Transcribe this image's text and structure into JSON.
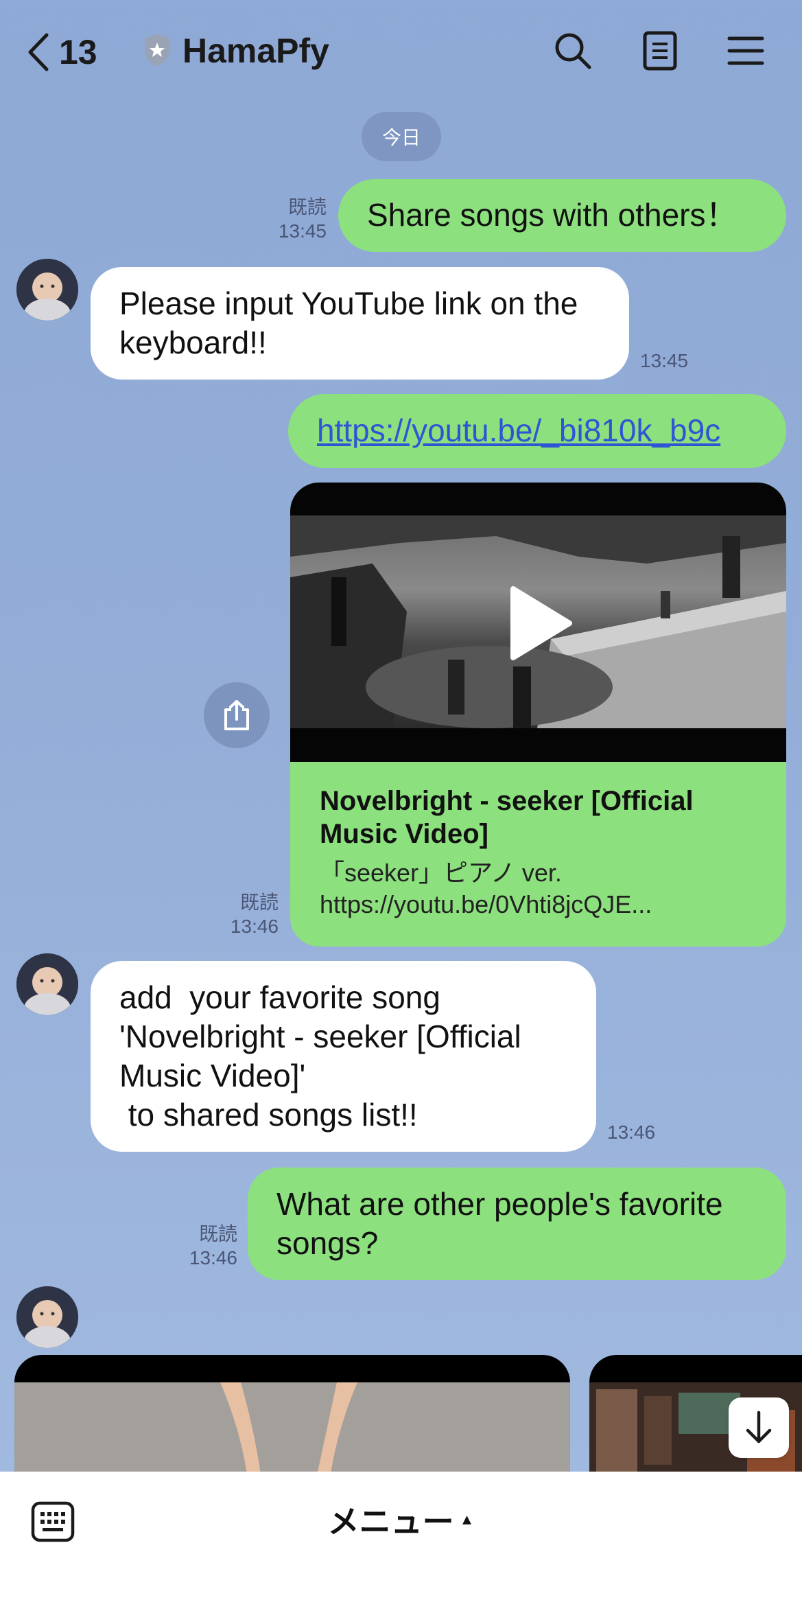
{
  "header": {
    "back_count": "13",
    "title": "HamaPfy"
  },
  "date_chip": "今日",
  "messages": [
    {
      "side": "right",
      "text": "Share songs with others！",
      "read": "既読",
      "time": "13:45"
    },
    {
      "side": "left",
      "text": "Please input YouTube link on the keyboard!!",
      "time": "13:45"
    },
    {
      "side": "right",
      "text": "https://youtu.be/_bi810k_b9c",
      "link": true
    },
    {
      "side": "right",
      "type": "link-card",
      "title": "Novelbright - seeker [Official Music Video]",
      "desc_line1": "「seeker」ピアノ ver.",
      "desc_line2": "https://youtu.be/0Vhti8jcQJE...",
      "read": "既読",
      "time": "13:46"
    },
    {
      "side": "left",
      "text_lines": [
        "add  your favorite song",
        "'Novelbright - seeker [Official",
        "Music Video]'",
        " to shared songs list!!"
      ],
      "time": "13:46"
    },
    {
      "side": "right",
      "text_lines": [
        "What are other people's favorite",
        "songs?"
      ],
      "read": "既読",
      "time": "13:46"
    }
  ],
  "bottom": {
    "menu_label": "メニュー",
    "menu_caret": "▲"
  },
  "colors": {
    "background": "#93add8",
    "outgoing_bubble": "#8de07e",
    "incoming_bubble": "#ffffff",
    "link": "#2f55d4"
  }
}
